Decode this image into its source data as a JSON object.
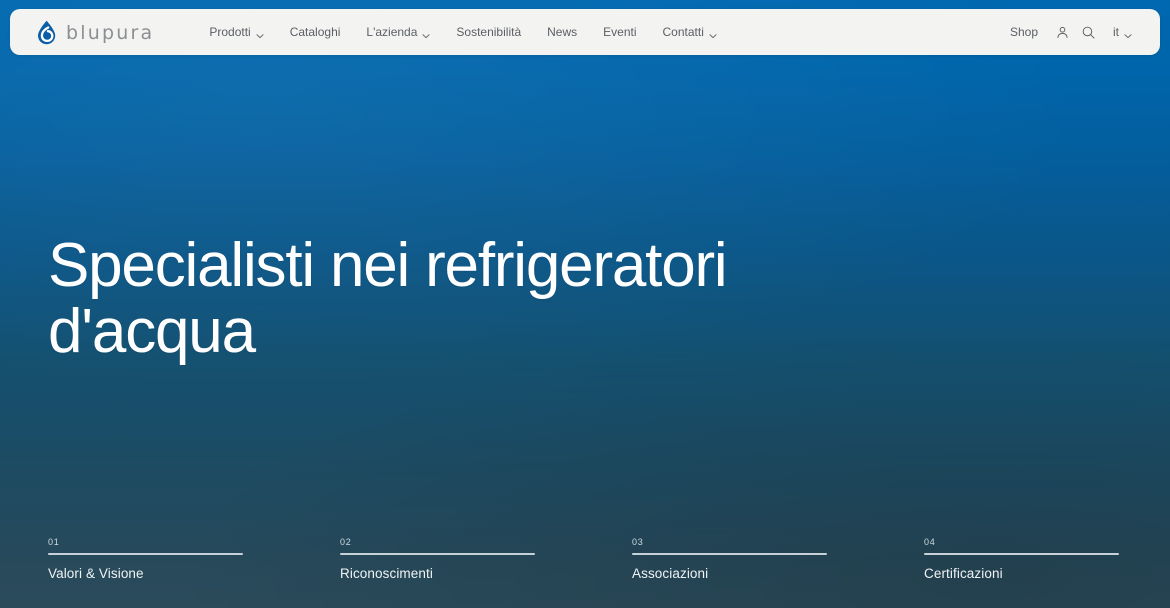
{
  "brand": {
    "name": "blupura",
    "logo_icon": "water-droplet-icon",
    "logo_color": "#0b5ea6"
  },
  "navbar": {
    "links": [
      {
        "label": "Prodotti",
        "has_dropdown": true
      },
      {
        "label": "Cataloghi",
        "has_dropdown": false
      },
      {
        "label": "L'azienda",
        "has_dropdown": true
      },
      {
        "label": "Sostenibilità",
        "has_dropdown": false
      },
      {
        "label": "News",
        "has_dropdown": false
      },
      {
        "label": "Eventi",
        "has_dropdown": false
      },
      {
        "label": "Contatti",
        "has_dropdown": true
      }
    ],
    "shop_label": "Shop",
    "account_icon": "user-icon",
    "search_icon": "search-icon",
    "language": {
      "code": "it",
      "chevron_icon": "chevron-down-icon"
    },
    "background_color": "#f3f3f2"
  },
  "hero": {
    "title": "Specialisti nei refrigeratori d'acqua",
    "gradient_top_color": "#0068b0",
    "gradient_bottom_color": "#2b4b5b",
    "title_color": "#ffffff"
  },
  "index_strip": {
    "items": [
      {
        "number": "01",
        "label": "Valori & Visione"
      },
      {
        "number": "02",
        "label": "Riconoscimenti"
      },
      {
        "number": "03",
        "label": "Associazioni"
      },
      {
        "number": "04",
        "label": "Certificazioni"
      }
    ],
    "rule_color": "#c6d2d8"
  }
}
